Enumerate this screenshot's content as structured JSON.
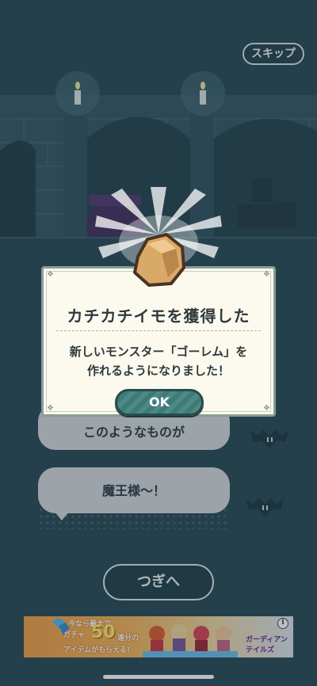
{
  "top": {
    "skip_label": "スキップ"
  },
  "dialogue": {
    "line_partial": "このようなものが",
    "line_main": "魔王様〜！"
  },
  "modal": {
    "title": "カチカチイモを獲得した",
    "message_line1": "新しいモンスター「ゴーレム」を",
    "message_line2": "作れるようになりました！",
    "ok_label": "OK"
  },
  "nav": {
    "next_label": "つぎへ"
  },
  "ad": {
    "line1": "今なら最大で",
    "line2": "ガチャ",
    "big": "50",
    "line2b": "連分の",
    "line3": "アイテムがもらえる!",
    "logo_text": "ガーディアンテイルズ",
    "info_label": "i"
  },
  "colors": {
    "background": "#2f4f5e",
    "modal_bg": "#fcf9ef",
    "ok_button": "#4c8a85"
  }
}
